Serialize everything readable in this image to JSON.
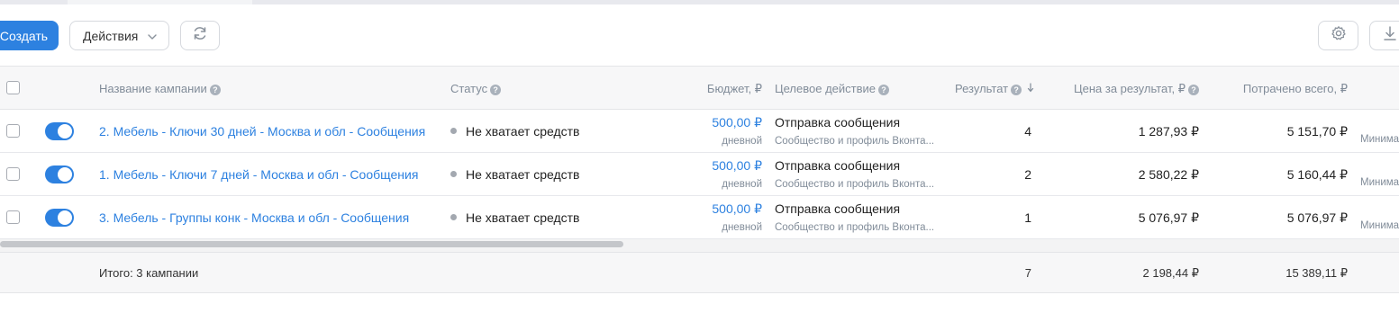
{
  "toolbar": {
    "create_label": "Создать",
    "actions_label": "Действия"
  },
  "table": {
    "headers": {
      "name": "Название кампании",
      "status": "Статус",
      "budget": "Бюджет, ₽",
      "target": "Целевое действие",
      "result": "Результат",
      "price": "Цена за результат, ₽",
      "spent": "Потрачено всего, ₽"
    },
    "rows": [
      {
        "enabled": true,
        "name": "2. Мебель - Ключи 30 дней - Москва и обл - Сообщения",
        "status": "Не хватает средств",
        "budget": "500,00 ₽",
        "budget_type": "дневной",
        "target": "Отправка сообщения",
        "target_sub": "Сообщество и профиль Вконта...",
        "result": "4",
        "price": "1 287,93 ₽",
        "spent": "5 151,70 ₽",
        "extra": "Минима"
      },
      {
        "enabled": true,
        "name": "1. Мебель - Ключи 7 дней - Москва и обл - Сообщения",
        "status": "Не хватает средств",
        "budget": "500,00 ₽",
        "budget_type": "дневной",
        "target": "Отправка сообщения",
        "target_sub": "Сообщество и профиль Вконта...",
        "result": "2",
        "price": "2 580,22 ₽",
        "spent": "5 160,44 ₽",
        "extra": "Минима"
      },
      {
        "enabled": true,
        "name": "3. Мебель - Группы конк - Москва и обл - Сообщения",
        "status": "Не хватает средств",
        "budget": "500,00 ₽",
        "budget_type": "дневной",
        "target": "Отправка сообщения",
        "target_sub": "Сообщество и профиль Вконта...",
        "result": "1",
        "price": "5 076,97 ₽",
        "spent": "5 076,97 ₽",
        "extra": "Минима"
      }
    ],
    "totals": {
      "label": "Итого: 3 кампании",
      "result": "7",
      "price": "2 198,44 ₽",
      "spent": "15 389,11 ₽"
    }
  },
  "colors": {
    "accent": "#2d81e0",
    "status_dot": "#a3a8b0"
  },
  "icons": [
    "refresh-icon",
    "gear-icon",
    "download-icon",
    "chevron-down-icon",
    "help-icon",
    "sort-down-icon"
  ]
}
